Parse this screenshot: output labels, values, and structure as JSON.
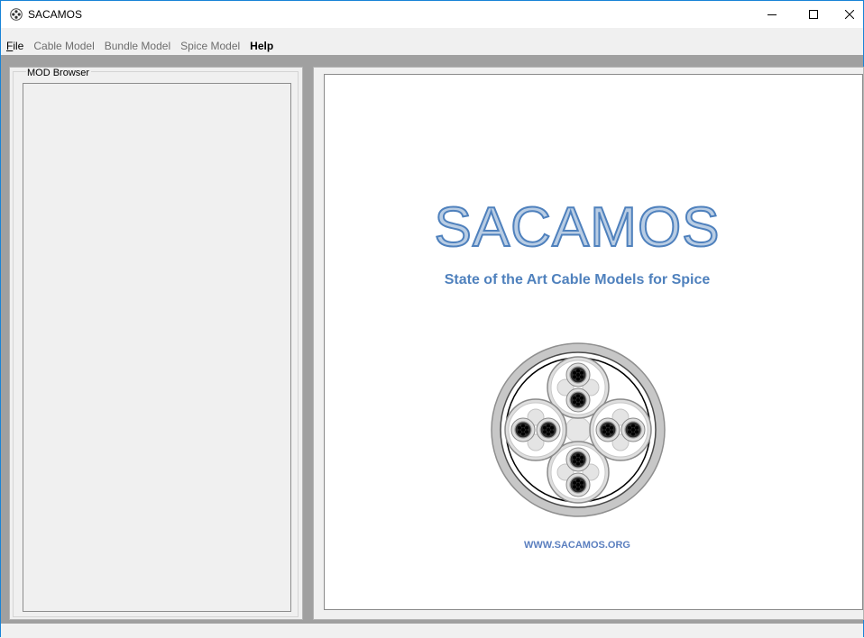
{
  "window": {
    "title": "SACAMOS",
    "controls": {
      "minimize": "minimize",
      "maximize": "maximize",
      "close": "close"
    }
  },
  "menu": {
    "items": [
      {
        "label": "File",
        "mnemonic": "F",
        "rest": "ile",
        "enabled": true
      },
      {
        "label": "Cable Model",
        "enabled": false
      },
      {
        "label": "Bundle Model",
        "enabled": false
      },
      {
        "label": "Spice Model",
        "enabled": false
      },
      {
        "label": "Help",
        "enabled": true
      }
    ]
  },
  "mod_browser": {
    "label": "MOD Browser",
    "items": []
  },
  "splash": {
    "title": "SACAMOS",
    "subtitle": "State of the Art Cable Models for Spice",
    "url": "WWW.SACAMOS.ORG"
  },
  "colors": {
    "accent_blue": "#4f81bd",
    "title_fill": "#b9cde4",
    "window_border": "#1883d7"
  }
}
